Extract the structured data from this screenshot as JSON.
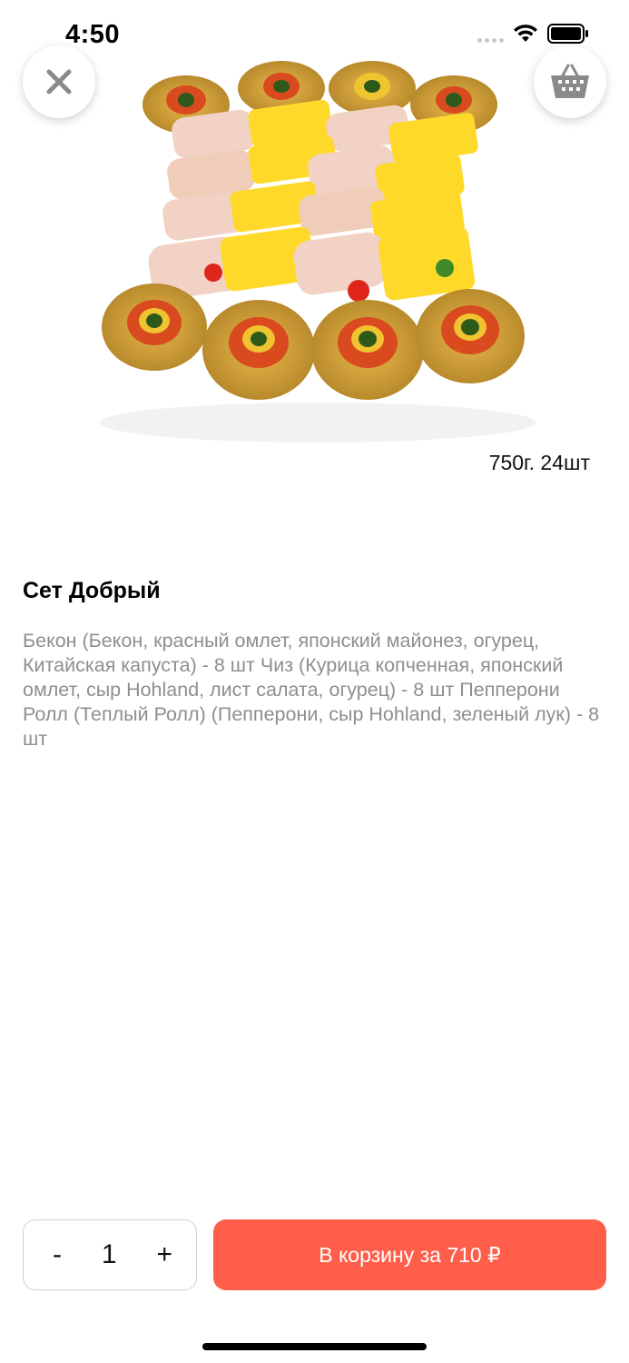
{
  "status_bar": {
    "time": "4:50"
  },
  "product": {
    "weight_count": "750г. 24шт",
    "title": "Сет Добрый",
    "description": "Бекон (Бекон, красный омлет, японский майонез, огурец, Китайская капуста) - 8 шт Чиз (Курица копченная, японский омлет, сыр Hohland, лист салата, огурец) - 8 шт Пепперони Ролл (Теплый Ролл) (Пепперони, сыр Hohland, зеленый лук) - 8 шт"
  },
  "quantity": {
    "minus": "-",
    "value": "1",
    "plus": "+"
  },
  "cart_button": {
    "label": "В корзину за 710 ₽"
  },
  "icons": {
    "close": "close-icon",
    "basket": "basket-icon"
  },
  "colors": {
    "accent": "#ff5f4a",
    "description_text": "#8e8e93"
  }
}
